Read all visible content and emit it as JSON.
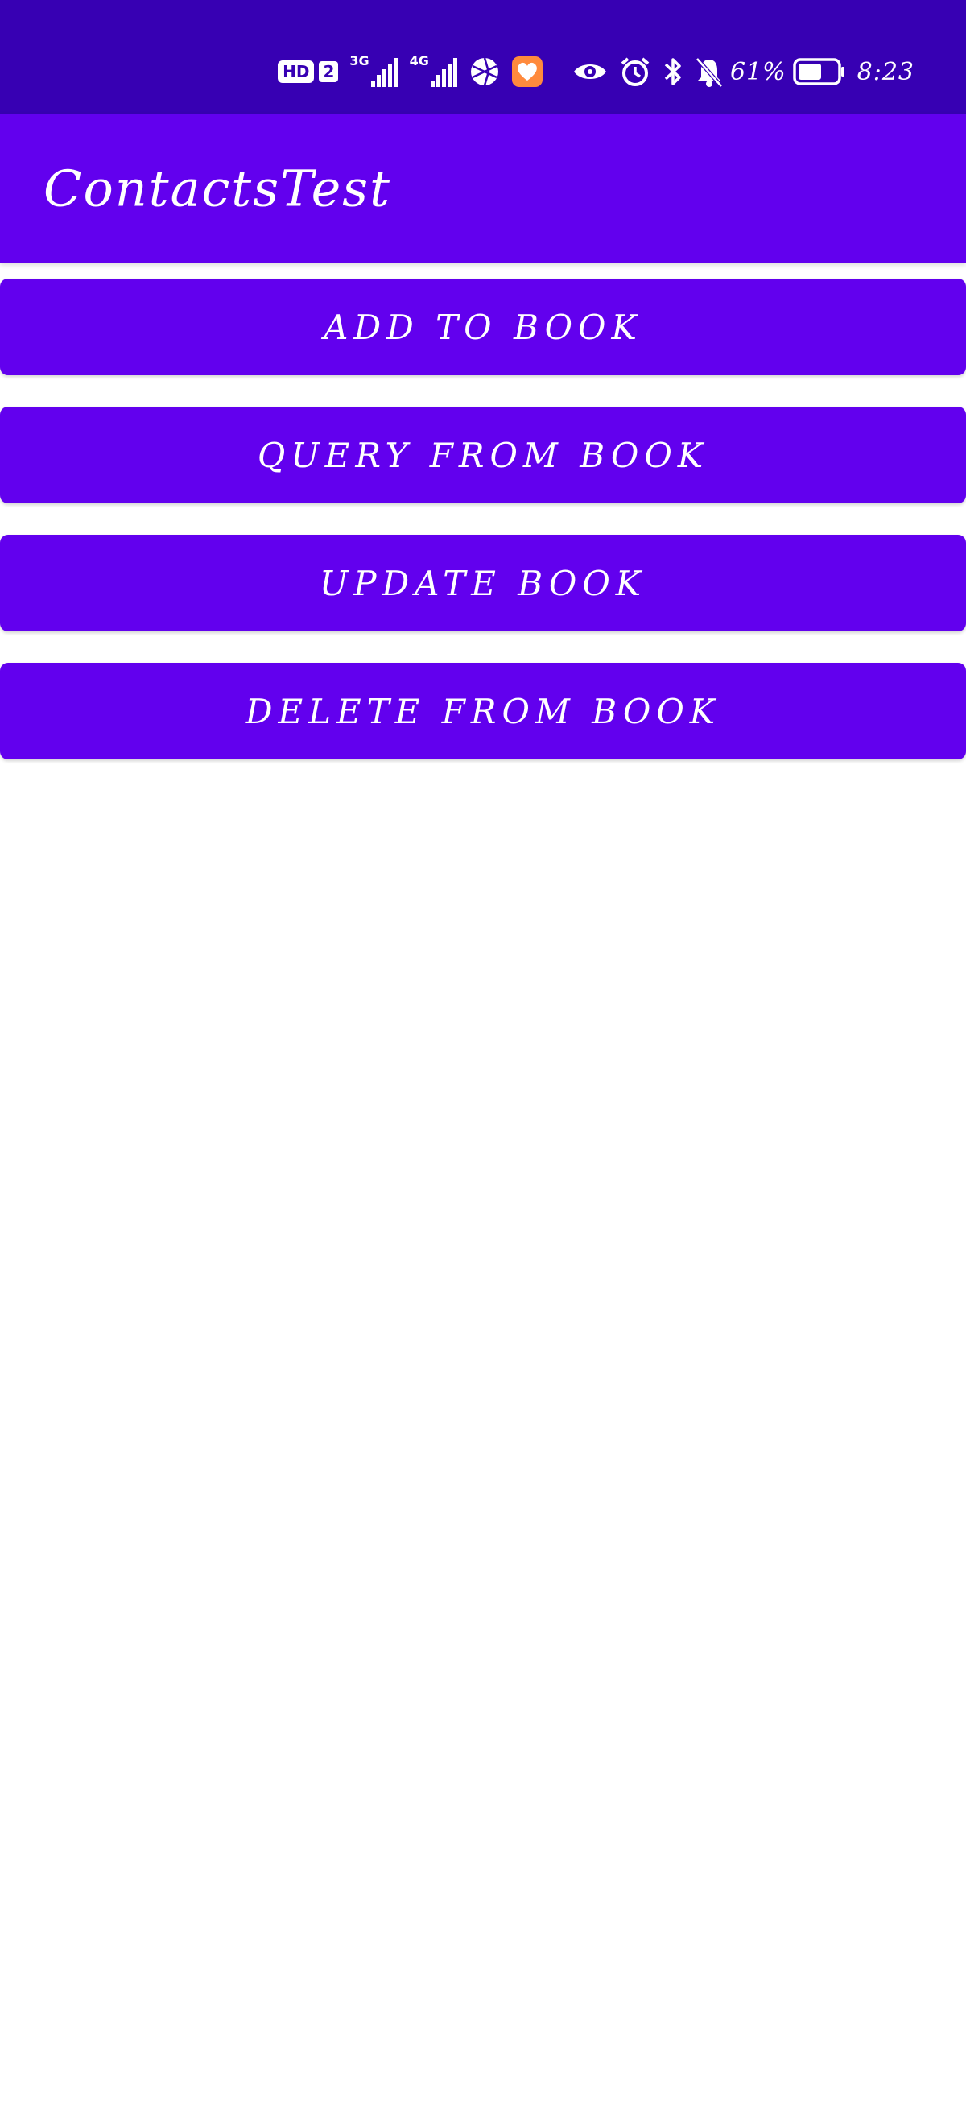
{
  "status_bar": {
    "hd_label": "HD",
    "sim_label": "2",
    "net1_label": "3G",
    "net2_label": "4G",
    "battery_percent": "61%",
    "battery_level": 0.61,
    "time": "8:23",
    "icons": [
      "hd-icon",
      "sim-2-icon",
      "signal-3g-icon",
      "signal-4g-icon",
      "browser-icon",
      "health-app-icon",
      "eye-comfort-icon",
      "alarm-icon",
      "bluetooth-icon",
      "mute-bell-icon",
      "battery-icon"
    ],
    "bg_color": "#3700b3"
  },
  "app_bar": {
    "title": "ContactsTest",
    "bg_color": "#6200ee"
  },
  "buttons": [
    {
      "label": "ADD TO BOOK"
    },
    {
      "label": "QUERY FROM BOOK"
    },
    {
      "label": "UPDATE BOOK"
    },
    {
      "label": "DELETE FROM BOOK"
    }
  ],
  "colors": {
    "primary": "#6200ee",
    "primary_dark": "#3700b3",
    "on_primary": "#ffffff",
    "background": "#ffffff"
  }
}
